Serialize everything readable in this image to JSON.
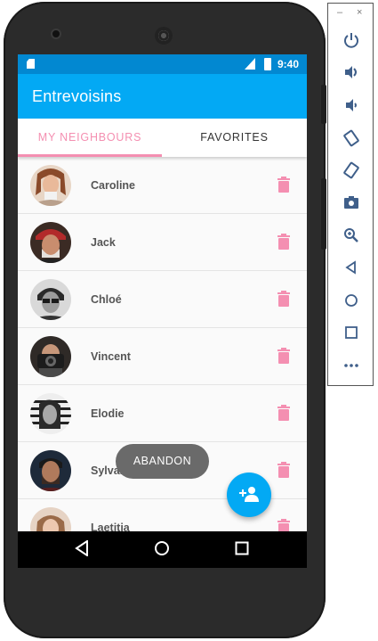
{
  "statusbar": {
    "time": "9:40",
    "network": "LTE"
  },
  "app": {
    "title": "Entrevoisins"
  },
  "tabs": [
    {
      "label": "MY NEIGHBOURS",
      "selected": true
    },
    {
      "label": "FAVORITES",
      "selected": false
    }
  ],
  "neighbours": [
    {
      "name": "Caroline"
    },
    {
      "name": "Jack"
    },
    {
      "name": "Chloé"
    },
    {
      "name": "Vincent"
    },
    {
      "name": "Elodie"
    },
    {
      "name": "Sylvain"
    },
    {
      "name": "Laetitia"
    }
  ],
  "toast": {
    "text": "ABANDON"
  },
  "fab": {
    "icon": "add-person-icon"
  },
  "navbar": {
    "icons": [
      "back-icon",
      "home-icon",
      "recents-icon"
    ]
  },
  "emulator_toolbar": {
    "window_controls": {
      "minimize": "–",
      "close": "×"
    },
    "icons": [
      "power-icon",
      "volume-up-icon",
      "volume-down-icon",
      "rotate-left-icon",
      "rotate-right-icon",
      "camera-icon",
      "zoom-icon",
      "back-icon",
      "home-icon",
      "overview-icon",
      "more-icon"
    ]
  },
  "colors": {
    "primary": "#03a9f4",
    "primary_dark": "#0288d1",
    "accent": "#f48fb1",
    "trash": "#f48fb1"
  }
}
